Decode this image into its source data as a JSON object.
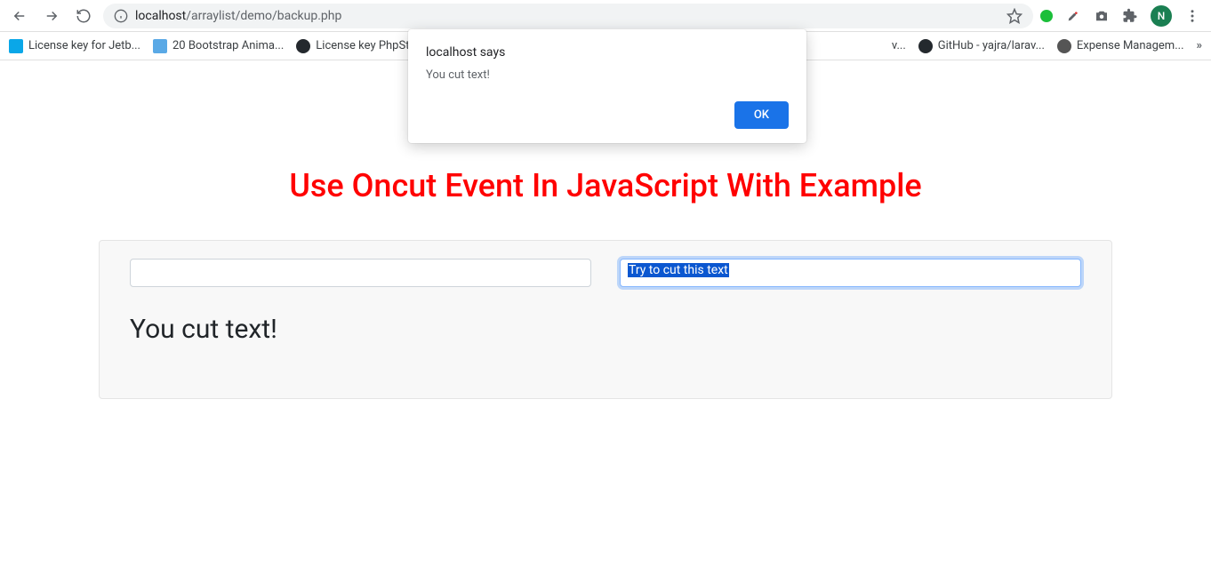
{
  "browser": {
    "url_host": "localhost",
    "url_path": "/arraylist/demo/backup.php",
    "profile_initial": "N"
  },
  "bookmarks": [
    {
      "label": "License key for Jetb...",
      "favicon": "#0aa7e8"
    },
    {
      "label": "20 Bootstrap Anima...",
      "favicon": "#5aa9e6"
    },
    {
      "label": "License key PhpStor...",
      "favicon": "#24292e"
    },
    {
      "label": "GitHub - yajra/larav...",
      "favicon": "#24292e"
    },
    {
      "label": "Expense Managem...",
      "favicon": "#555"
    }
  ],
  "truncatedText": "v...",
  "dialog": {
    "title": "localhost says",
    "message": "You cut text!",
    "ok_label": "OK"
  },
  "page": {
    "heading": "Use Oncut Event In JavaScript With Example",
    "input1_value": "",
    "input2_value": "Try to cut this text",
    "result": "You cut text!"
  }
}
